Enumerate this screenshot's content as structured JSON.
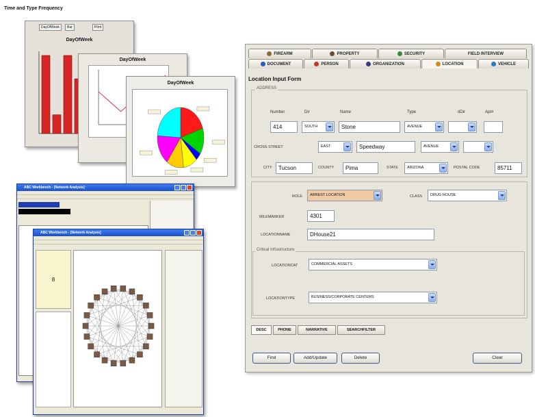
{
  "page_title": "Time and Type Frequency",
  "charts": {
    "bar": {
      "title": "DayOfWeek",
      "ctrl_1": "DayOfWeek",
      "ctrl_2": "Bar",
      "ctrl_3": "Print",
      "colors": [
        "#d62626"
      ],
      "values": [
        5,
        1.2,
        5,
        3.5,
        4.2
      ]
    },
    "line": {
      "title": "DayOfWeek",
      "values": [
        3,
        1.2,
        3,
        4.5
      ]
    },
    "pie": {
      "title": "DayOfWeek",
      "colors": [
        "#ff1a1a",
        "#00d400",
        "#0000ff",
        "#ffff00",
        "#ffcc00",
        "#ff00ff",
        "#00ffff"
      ],
      "values": [
        20,
        14,
        4,
        10,
        12,
        16,
        24
      ]
    }
  },
  "analyst": {
    "back_title": "ABC Workbench - [Network Analysis]",
    "front_title": "ABC Workbench - [Network Analysis]",
    "sample_label": "8"
  },
  "form": {
    "tabs_top": [
      {
        "label": "Firearm",
        "icon_color": "#8a6b3a"
      },
      {
        "label": "Property",
        "icon_color": "#6b4a3a"
      },
      {
        "label": "Security",
        "icon_color": "#3a8a3a"
      },
      {
        "label": "Field Interview",
        "icon_color": ""
      }
    ],
    "tabs_bottom": [
      {
        "label": "Document",
        "icon_color": "#2a5cc0"
      },
      {
        "label": "Person",
        "icon_color": "#c03a2a"
      },
      {
        "label": "Organization",
        "icon_color": "#3a3a80"
      },
      {
        "label": "Location",
        "icon_color": "#d48a1a"
      },
      {
        "label": "Vehicle",
        "icon_color": "#2a7ac0"
      }
    ],
    "heading": "Location Input Form",
    "address": {
      "group_label": "ADDRESS",
      "labels": {
        "number": "Number",
        "dir": "Dir",
        "name": "Name",
        "type": "Type",
        "dir2": "dDir",
        "apt": "Apt#"
      },
      "number": "414",
      "dir": "SOUTH",
      "name": "Stone",
      "type": "AVENUE",
      "cross_street_label": "CROSS STREET",
      "cross_dir": "EAST",
      "cross_name": "Speedway",
      "cross_type": "AVENUE",
      "city_label": "CITY",
      "city": "Tucson",
      "county_label": "COUNTY",
      "county": "Pima",
      "state_label": "STATE",
      "state": "ARIZONA",
      "postal_label": "POSTAL CODE",
      "postal": "85711"
    },
    "role_label": "ROLE",
    "role": "ARREST LOCATION",
    "class_label": "CLASS",
    "class_value": "DRUG HOUSE",
    "milemarker_label": "MILEMARKER",
    "milemarker": "4301",
    "locationname_label": "LOCATIONNAME",
    "locationname": "DHouse21",
    "critical_label": "Critical Infrastructure",
    "locationcat_label": "LOCATIONCAT",
    "locationcat": "COMMERCIAL ASSETS",
    "locationtype_label": "LOCATIONTYPE",
    "locationtype": "BUSINESS/CORPORATE CENTERS",
    "sub_tabs": [
      "Desc",
      "Phone",
      "Narrative",
      "SearchFilter"
    ],
    "buttons": {
      "find": "Find",
      "add_update": "Add/Update",
      "delete": "Delete",
      "clear": "Clear"
    }
  }
}
